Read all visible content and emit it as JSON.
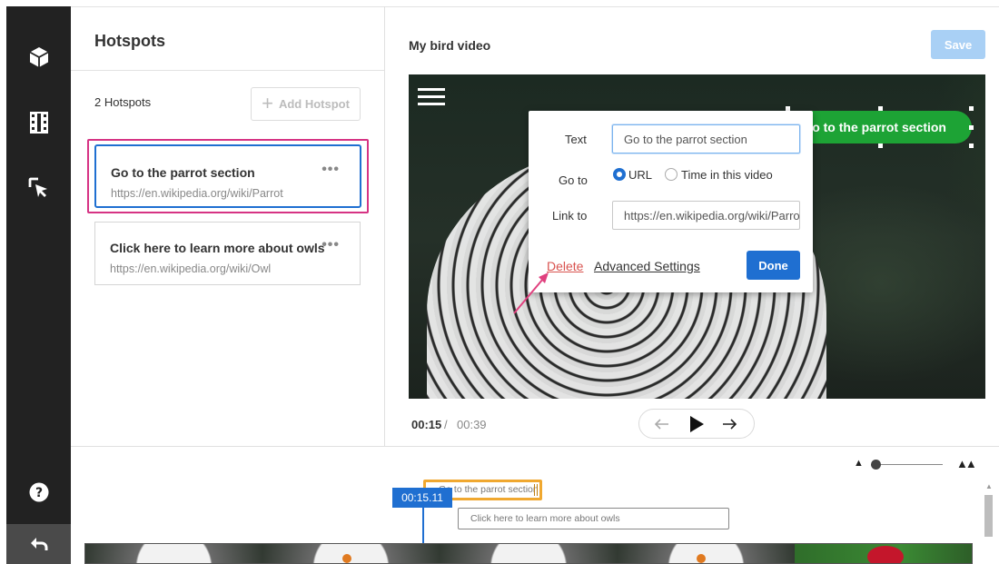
{
  "sidebar_panel": {
    "title": "Hotspots",
    "count_label": "2 Hotspots",
    "add_button_label": "Add Hotspot",
    "hotspots": [
      {
        "title": "Go to the parrot section",
        "url": "https://en.wikipedia.org/wiki/Parrot",
        "more": "•••"
      },
      {
        "title": "Click here to learn more about owls",
        "url": "https://en.wikipedia.org/wiki/Owl",
        "more": "•••"
      }
    ]
  },
  "header": {
    "video_title": "My bird video",
    "save_label": "Save"
  },
  "video": {
    "hotspot_label": "Go to the parrot section"
  },
  "editor": {
    "text_label": "Text",
    "text_value": "Go to the parrot section",
    "goto_label": "Go to",
    "option_url": "URL",
    "option_time": "Time in this video",
    "link_label": "Link to",
    "link_value": "https://en.wikipedia.org/wiki/Parrot",
    "delete_label": "Delete",
    "advanced_label": "Advanced Settings",
    "done_label": "Done"
  },
  "player": {
    "current_time": "00:15",
    "separator": "/",
    "duration": "00:39"
  },
  "timeline": {
    "playhead_time": "00:15.11",
    "track1_label": "Go to the parrot section",
    "track2_label": "Click here to learn more about owls"
  },
  "colors": {
    "accent": "#1f6fd1",
    "hotspot_green": "#1da335",
    "delete_red": "#d9534f",
    "highlight_pink": "#d63384",
    "track_orange": "#f0a830"
  }
}
